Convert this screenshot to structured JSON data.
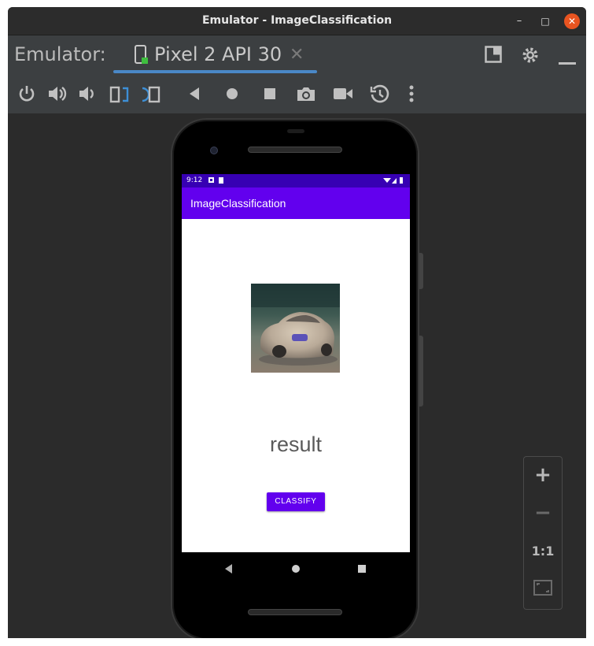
{
  "window": {
    "title": "Emulator - ImageClassification",
    "controls": {
      "minimize": "–",
      "maximize": "□",
      "close": "✕"
    }
  },
  "tabbar": {
    "label": "Emulator:",
    "active_tab": "Pixel 2 API 30",
    "tab_close": "✕",
    "accent_color": "#4a88c7"
  },
  "toolbar": {
    "tools": [
      "power-icon",
      "volume-up-icon",
      "volume-down-icon",
      "rotate-left-icon",
      "rotate-right-icon",
      "back-icon",
      "home-icon",
      "overview-icon",
      "camera-icon",
      "record-icon",
      "snapshot-icon",
      "more-icon"
    ]
  },
  "device": {
    "status_time": "9:12",
    "app_title": "ImageClassification",
    "result_text": "result",
    "classify_label": "CLASSIFY",
    "primary_color": "#6200ee",
    "status_color": "#3700b3"
  },
  "zoom": {
    "zoom_in": "+",
    "zoom_out": "−",
    "one_to_one": "1:1"
  }
}
